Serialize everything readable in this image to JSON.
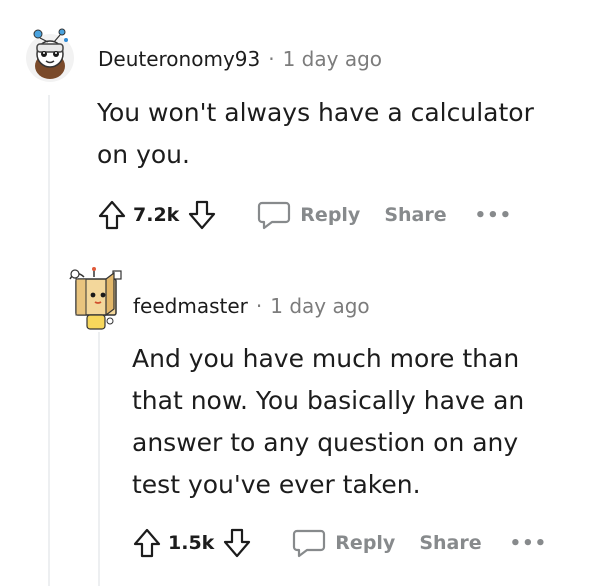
{
  "comments": [
    {
      "author": "Deuteronomy93",
      "separator": "·",
      "time": "1 day ago",
      "lines": [
        "You won't always have a calculator",
        "on you."
      ],
      "votes": "7.2k",
      "reply_label": "Reply",
      "share_label": "Share",
      "more_label": "•••"
    },
    {
      "author": "feedmaster",
      "separator": "·",
      "time": "1 day ago",
      "lines": [
        "And you have much more than",
        "that now. You basically have an",
        "answer to any question on any",
        "test you've ever taken."
      ],
      "votes": "1.5k",
      "reply_label": "Reply",
      "share_label": "Share",
      "more_label": "•••"
    }
  ]
}
